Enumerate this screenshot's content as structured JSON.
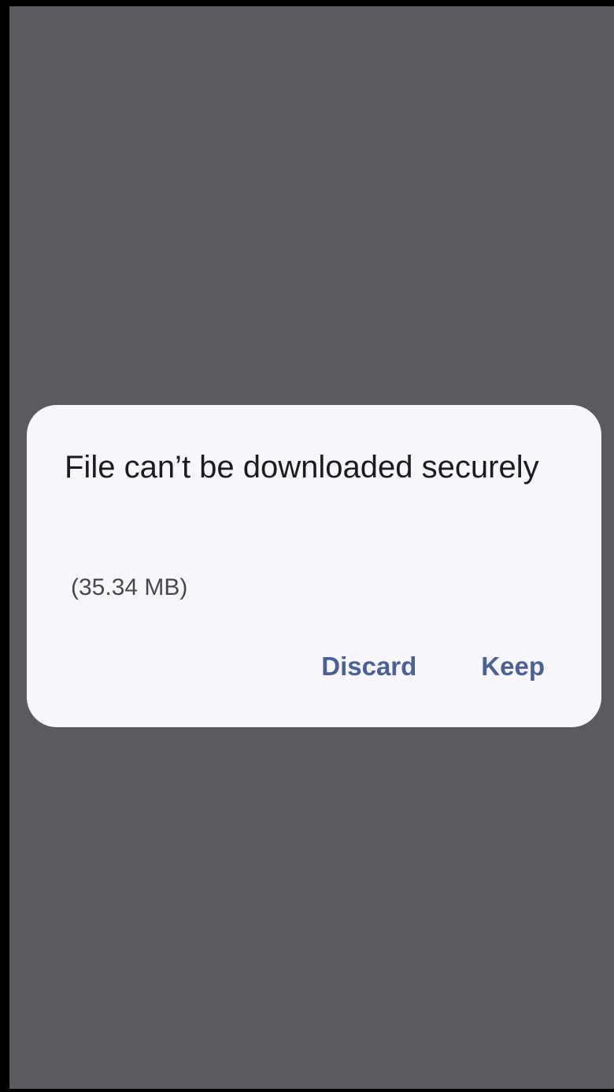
{
  "dialog": {
    "title": "File can’t be downloaded securely",
    "file_size": "(35.34 MB)",
    "discard_label": "Discard",
    "keep_label": "Keep"
  },
  "colors": {
    "scrim": "#5b5a60",
    "dialog_background": "#f7f6fb",
    "action_text": "#4b6194",
    "title_text": "#1d1b20"
  }
}
